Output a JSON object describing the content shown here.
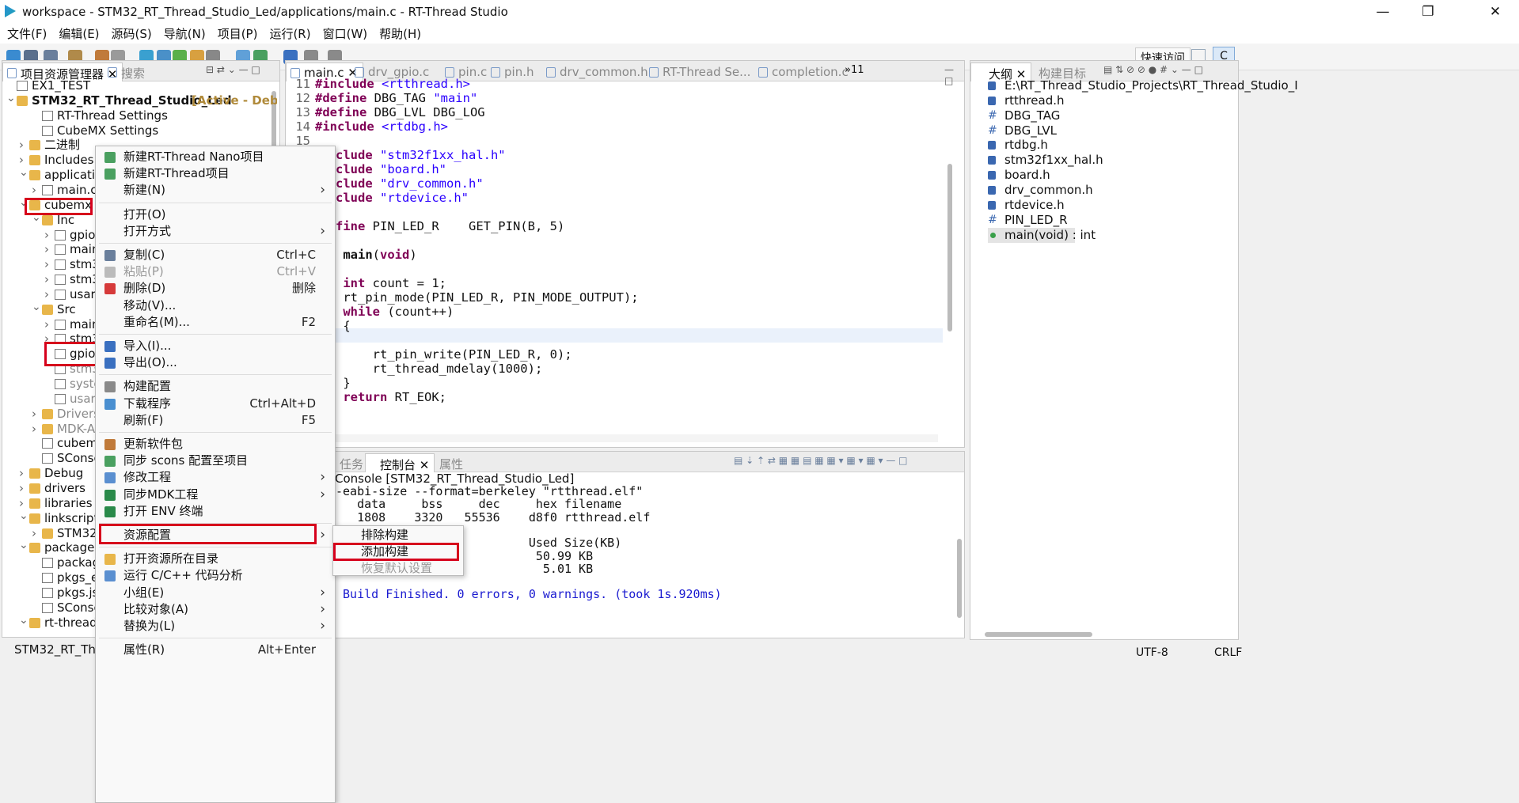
{
  "window": {
    "title": "workspace - STM32_RT_Thread_Studio_Led/applications/main.c - RT-Thread Studio"
  },
  "menubar": [
    "文件(F)",
    "编辑(E)",
    "源码(S)",
    "导航(N)",
    "项目(P)",
    "运行(R)",
    "窗口(W)",
    "帮助(H)"
  ],
  "toolbar": {
    "quick_access": "快速访问",
    "perspective": "C"
  },
  "left_panel": {
    "tabs": [
      "项目资源管理器",
      "搜索"
    ],
    "tree": [
      {
        "label": "EX1_TEST",
        "depth": 0,
        "arrow": ""
      },
      {
        "label": "STM32_RT_Thread_Studio_Led",
        "depth": 0,
        "arrow": "v",
        "suffix": "[Active - Debug"
      },
      {
        "label": "RT-Thread Settings",
        "depth": 2,
        "arrow": ""
      },
      {
        "label": "CubeMX Settings",
        "depth": 2,
        "arrow": ""
      },
      {
        "label": "二进制",
        "depth": 1,
        "arrow": ">"
      },
      {
        "label": "Includes",
        "depth": 1,
        "arrow": ">"
      },
      {
        "label": "application",
        "depth": 1,
        "arrow": "v"
      },
      {
        "label": "main.c",
        "depth": 2,
        "arrow": ">"
      },
      {
        "label": "cubemx",
        "depth": 1,
        "arrow": "v"
      },
      {
        "label": "Inc",
        "depth": 2,
        "arrow": "v"
      },
      {
        "label": "gpio.",
        "depth": 3,
        "arrow": ">"
      },
      {
        "label": "main.",
        "depth": 3,
        "arrow": ">"
      },
      {
        "label": "stm3.",
        "depth": 3,
        "arrow": ">"
      },
      {
        "label": "stm3.",
        "depth": 3,
        "arrow": ">"
      },
      {
        "label": "usart.",
        "depth": 3,
        "arrow": ">"
      },
      {
        "label": "Src",
        "depth": 2,
        "arrow": "v"
      },
      {
        "label": "main.",
        "depth": 3,
        "arrow": ">"
      },
      {
        "label": "stm3.",
        "depth": 3,
        "arrow": ">"
      },
      {
        "label": "gpio.",
        "depth": 3,
        "arrow": ""
      },
      {
        "label": "stm3.",
        "depth": 3,
        "arrow": ""
      },
      {
        "label": "syste",
        "depth": 3,
        "arrow": ""
      },
      {
        "label": "usart.",
        "depth": 3,
        "arrow": ""
      },
      {
        "label": "Drivers",
        "depth": 2,
        "arrow": ">"
      },
      {
        "label": "MDK-AR",
        "depth": 2,
        "arrow": ">"
      },
      {
        "label": "cubemx",
        "depth": 2,
        "arrow": ""
      },
      {
        "label": "SConscr",
        "depth": 2,
        "arrow": ""
      },
      {
        "label": "Debug",
        "depth": 1,
        "arrow": ">"
      },
      {
        "label": "drivers",
        "depth": 1,
        "arrow": ">"
      },
      {
        "label": "libraries",
        "depth": 1,
        "arrow": ">"
      },
      {
        "label": "linkscripts",
        "depth": 1,
        "arrow": "v"
      },
      {
        "label": "STM32F",
        "depth": 2,
        "arrow": ">"
      },
      {
        "label": "packages",
        "depth": 1,
        "arrow": "v"
      },
      {
        "label": "package",
        "depth": 2,
        "arrow": ""
      },
      {
        "label": "pkgs_er",
        "depth": 2,
        "arrow": ""
      },
      {
        "label": "pkgs.jsc",
        "depth": 2,
        "arrow": ""
      },
      {
        "label": "SConscr",
        "depth": 2,
        "arrow": ""
      },
      {
        "label": "rt-thread [",
        "depth": 1,
        "arrow": "v"
      }
    ],
    "status": "STM32_RT_Thread"
  },
  "editor": {
    "tabs": [
      "main.c",
      "drv_gpio.c",
      "pin.c",
      "pin.h",
      "drv_common.h",
      "RT-Thread Se...",
      "completion.c"
    ],
    "overflow": "»11",
    "lines": [
      {
        "n": "11",
        "parts": [
          [
            "kw",
            "#include "
          ],
          [
            "str",
            "<rtthread.h>"
          ]
        ]
      },
      {
        "n": "12",
        "parts": [
          [
            "kw",
            "#define "
          ],
          [
            "",
            "DBG_TAG "
          ],
          [
            "str",
            "\"main\""
          ]
        ]
      },
      {
        "n": "13",
        "parts": [
          [
            "kw",
            "#define "
          ],
          [
            "",
            "DBG_LVL DBG_LOG"
          ]
        ]
      },
      {
        "n": "14",
        "parts": [
          [
            "kw",
            "#include "
          ],
          [
            "str",
            "<rtdbg.h>"
          ]
        ]
      },
      {
        "n": "15",
        "parts": []
      },
      {
        "n": "",
        "parts": [
          [
            "kw",
            "clude "
          ],
          [
            "str",
            "\"stm32f1xx_hal.h\""
          ]
        ]
      },
      {
        "n": "",
        "parts": [
          [
            "kw",
            "clude "
          ],
          [
            "str",
            "\"board.h\""
          ]
        ]
      },
      {
        "n": "",
        "parts": [
          [
            "kw",
            "clude "
          ],
          [
            "str",
            "\"drv_common.h\""
          ]
        ]
      },
      {
        "n": "",
        "parts": [
          [
            "kw",
            "clude "
          ],
          [
            "str",
            "\"rtdevice.h\""
          ]
        ]
      },
      {
        "n": "",
        "parts": []
      },
      {
        "n": "",
        "parts": [
          [
            "kw",
            "fine "
          ],
          [
            "",
            "PIN_LED_R    GET_PIN(B, 5)"
          ]
        ]
      },
      {
        "n": "",
        "parts": []
      },
      {
        "n": "",
        "parts": [
          [
            "",
            " "
          ],
          [
            "b",
            "main"
          ],
          [
            "",
            "("
          ],
          [
            "kw",
            "void"
          ],
          [
            "",
            ")"
          ]
        ]
      },
      {
        "n": "",
        "parts": []
      },
      {
        "n": "",
        "parts": [
          [
            "",
            " "
          ],
          [
            "kw",
            "int"
          ],
          [
            "",
            " count = 1;"
          ]
        ]
      },
      {
        "n": "",
        "parts": [
          [
            "",
            " rt_pin_mode(PIN_LED_R, PIN_MODE_OUTPUT);"
          ]
        ]
      },
      {
        "n": "",
        "parts": [
          [
            "",
            " "
          ],
          [
            "kw",
            "while"
          ],
          [
            "",
            " (count++)"
          ]
        ]
      },
      {
        "n": "",
        "parts": [
          [
            "",
            " {"
          ]
        ]
      },
      {
        "n": "",
        "parts": []
      },
      {
        "n": "",
        "parts": [
          [
            "",
            "     rt_pin_write(PIN_LED_R, 0);"
          ]
        ]
      },
      {
        "n": "",
        "parts": [
          [
            "",
            "     rt_thread_mdelay(1000);"
          ]
        ]
      },
      {
        "n": "",
        "parts": [
          [
            "",
            " }"
          ]
        ]
      },
      {
        "n": "",
        "parts": [
          [
            "",
            " "
          ],
          [
            "kw",
            "return"
          ],
          [
            "",
            " RT_EOK;"
          ]
        ]
      }
    ]
  },
  "console": {
    "tabs": [
      "任务",
      "控制台",
      "属性"
    ],
    "header": "Console [STM32_RT_Thread_Studio_Led]",
    "lines": [
      "-eabi-size --format=berkeley \"rtthread.elf\"",
      "   data     bss     dec     hex filename",
      "   1808    3320   55536    d8f0 rtthread.elf",
      "",
      "                           Used Size(KB)",
      "                            50.99 KB",
      "                             5.01 KB",
      "",
      " Build Finished. 0 errors, 0 warnings. (took 1s.920ms)"
    ]
  },
  "outline": {
    "tabs": [
      "大纲",
      "构建目标"
    ],
    "items": [
      {
        "label": "E:\\RT_Thread_Studio_Projects\\RT_Thread_Studio_I",
        "kind": "inc"
      },
      {
        "label": "rtthread.h",
        "kind": "inc"
      },
      {
        "label": "DBG_TAG",
        "kind": "def"
      },
      {
        "label": "DBG_LVL",
        "kind": "def"
      },
      {
        "label": "rtdbg.h",
        "kind": "inc"
      },
      {
        "label": "stm32f1xx_hal.h",
        "kind": "inc"
      },
      {
        "label": "board.h",
        "kind": "inc"
      },
      {
        "label": "drv_common.h",
        "kind": "inc"
      },
      {
        "label": "rtdevice.h",
        "kind": "inc"
      },
      {
        "label": "PIN_LED_R",
        "kind": "def"
      },
      {
        "label": "main(void) : int",
        "kind": "fn"
      }
    ]
  },
  "context_menu": {
    "items": [
      {
        "label": "新建RT-Thread Nano项目",
        "shortcut": "",
        "sub": false,
        "dis": false
      },
      {
        "label": "新建RT-Thread项目",
        "shortcut": "",
        "sub": false,
        "dis": false
      },
      {
        "label": "新建(N)",
        "shortcut": "",
        "sub": true,
        "dis": false
      },
      {
        "sep": true
      },
      {
        "label": "打开(O)",
        "shortcut": "",
        "sub": false,
        "dis": false
      },
      {
        "label": "打开方式",
        "shortcut": "",
        "sub": true,
        "dis": false
      },
      {
        "sep": true
      },
      {
        "label": "复制(C)",
        "shortcut": "Ctrl+C",
        "sub": false,
        "dis": false
      },
      {
        "label": "粘贴(P)",
        "shortcut": "Ctrl+V",
        "sub": false,
        "dis": true
      },
      {
        "label": "删除(D)",
        "shortcut": "删除",
        "sub": false,
        "dis": false
      },
      {
        "label": "移动(V)...",
        "shortcut": "",
        "sub": false,
        "dis": false
      },
      {
        "label": "重命名(M)...",
        "shortcut": "F2",
        "sub": false,
        "dis": false
      },
      {
        "sep": true
      },
      {
        "label": "导入(I)...",
        "shortcut": "",
        "sub": false,
        "dis": false
      },
      {
        "label": "导出(O)...",
        "shortcut": "",
        "sub": false,
        "dis": false
      },
      {
        "sep": true
      },
      {
        "label": "构建配置",
        "shortcut": "",
        "sub": false,
        "dis": false
      },
      {
        "label": "下载程序",
        "shortcut": "Ctrl+Alt+D",
        "sub": false,
        "dis": false
      },
      {
        "label": "刷新(F)",
        "shortcut": "F5",
        "sub": false,
        "dis": false
      },
      {
        "sep": true
      },
      {
        "label": "更新软件包",
        "shortcut": "",
        "sub": false,
        "dis": false
      },
      {
        "label": "同步 scons 配置至项目",
        "shortcut": "",
        "sub": false,
        "dis": false
      },
      {
        "label": "修改工程",
        "shortcut": "",
        "sub": true,
        "dis": false
      },
      {
        "label": "同步MDK工程",
        "shortcut": "",
        "sub": true,
        "dis": false
      },
      {
        "label": "打开 ENV 终端",
        "shortcut": "",
        "sub": false,
        "dis": false
      },
      {
        "sep": true
      },
      {
        "label": "资源配置",
        "shortcut": "",
        "sub": true,
        "dis": false
      },
      {
        "sep": true
      },
      {
        "label": "打开资源所在目录",
        "shortcut": "",
        "sub": false,
        "dis": false
      },
      {
        "label": "运行 C/C++ 代码分析",
        "shortcut": "",
        "sub": false,
        "dis": false
      },
      {
        "label": "小组(E)",
        "shortcut": "",
        "sub": true,
        "dis": false
      },
      {
        "label": "比较对象(A)",
        "shortcut": "",
        "sub": true,
        "dis": false
      },
      {
        "label": "替换为(L)",
        "shortcut": "",
        "sub": true,
        "dis": false
      },
      {
        "sep": true
      },
      {
        "label": "属性(R)",
        "shortcut": "Alt+Enter",
        "sub": false,
        "dis": false
      }
    ]
  },
  "submenu": {
    "items": [
      {
        "label": "排除构建",
        "dis": false
      },
      {
        "label": "添加构建",
        "dis": false
      },
      {
        "label": "恢复默认设置",
        "dis": true
      }
    ]
  },
  "statusbar": {
    "encoding": "UTF-8",
    "line_ending": "CRLF"
  },
  "colors": {
    "highlight_red": "#d6001c",
    "keyword": "#7f0055",
    "string": "#2a00ff"
  }
}
